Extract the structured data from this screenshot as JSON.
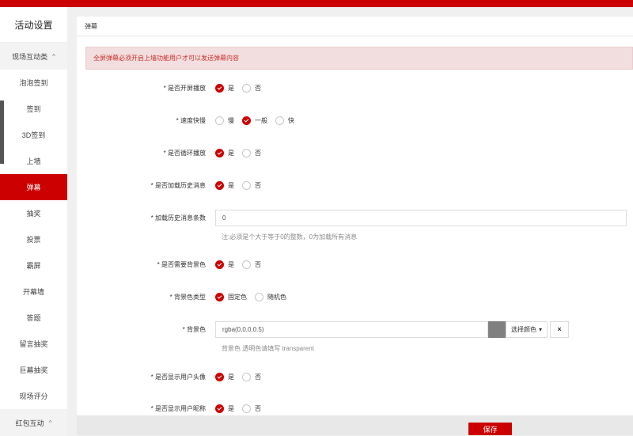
{
  "sidebar": {
    "title": "活动设置",
    "groups": [
      {
        "label": "现场互动类",
        "chevron": "^",
        "items": [
          "泡泡签到",
          "签到",
          "3D签到",
          "上墙",
          "弹幕",
          "抽奖",
          "投票",
          "霸屏",
          "开幕墙",
          "答题",
          "留言抽奖",
          "巨幕抽奖",
          "现场评分"
        ]
      },
      {
        "label": "红包互动",
        "chevron": "^"
      }
    ],
    "active_item": "弹幕"
  },
  "panel": {
    "header": "弹幕",
    "alert": "全屏弹幕必须开启上墙功能用户才可以发送弹幕内容"
  },
  "form": {
    "fullscreen": {
      "label": "* 是否开屏播放",
      "options": [
        "是",
        "否"
      ],
      "selected": 0
    },
    "speed": {
      "label": "* 速度快慢",
      "options": [
        "慢",
        "一般",
        "快"
      ],
      "selected": 1
    },
    "loop": {
      "label": "* 是否循环播放",
      "options": [
        "是",
        "否"
      ],
      "selected": 0
    },
    "history": {
      "label": "* 是否加载历史消息",
      "options": [
        "是",
        "否"
      ],
      "selected": 0
    },
    "history_count": {
      "label": "* 加载历史消息条数",
      "value": "0",
      "help": "注:必须是个大于等于0的整数，0为加载所有消息"
    },
    "need_bg": {
      "label": "* 是否需要背景色",
      "options": [
        "是",
        "否"
      ],
      "selected": 0
    },
    "bg_type": {
      "label": "* 背景色类型",
      "options": [
        "固定色",
        "随机色"
      ],
      "selected": 0
    },
    "bg_color": {
      "label": "* 背景色",
      "value": "rgba(0,0,0,0.5)",
      "pick_label": "选择颜色",
      "clear_label": "×",
      "swatch_color": "#808080",
      "help": "背景色 透明色请填写 transparent"
    },
    "show_avatar": {
      "label": "* 是否显示用户头像",
      "options": [
        "是",
        "否"
      ],
      "selected": 0
    },
    "show_nickname": {
      "label": "* 是否显示用户昵称",
      "options": [
        "是",
        "否"
      ],
      "selected": 0
    }
  },
  "footer": {
    "save_label": "保存"
  },
  "colors": {
    "accent": "#cc0000",
    "alert_bg": "#f2dede",
    "alert_text": "#c9302c"
  }
}
